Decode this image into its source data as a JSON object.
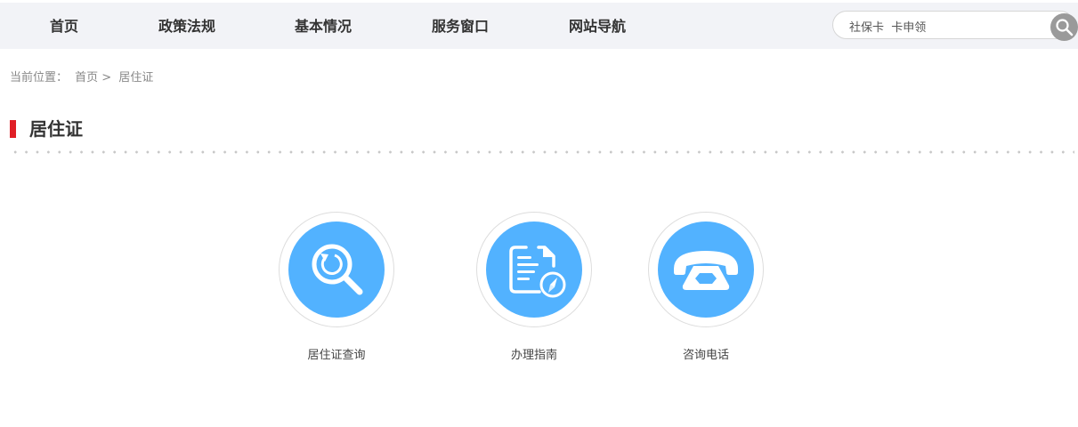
{
  "nav": {
    "items": [
      {
        "label": "首页"
      },
      {
        "label": "政策法规"
      },
      {
        "label": "基本情况"
      },
      {
        "label": "服务窗口"
      },
      {
        "label": "网站导航"
      }
    ]
  },
  "search": {
    "value": "社保卡  卡申领",
    "icon": "search-icon"
  },
  "breadcrumb": {
    "prefix": "当前位置：",
    "home": "首页 >",
    "current": "居住证"
  },
  "page": {
    "title": "居住证"
  },
  "services": [
    {
      "label": "居住证查询",
      "icon": "search-refresh-icon"
    },
    {
      "label": "办理指南",
      "icon": "document-compass-icon"
    },
    {
      "label": "咨询电话",
      "icon": "telephone-icon"
    }
  ],
  "colors": {
    "accent": "#e01f26",
    "icon_bg": "#52b2ff",
    "nav_bg": "#f2f3f7"
  }
}
